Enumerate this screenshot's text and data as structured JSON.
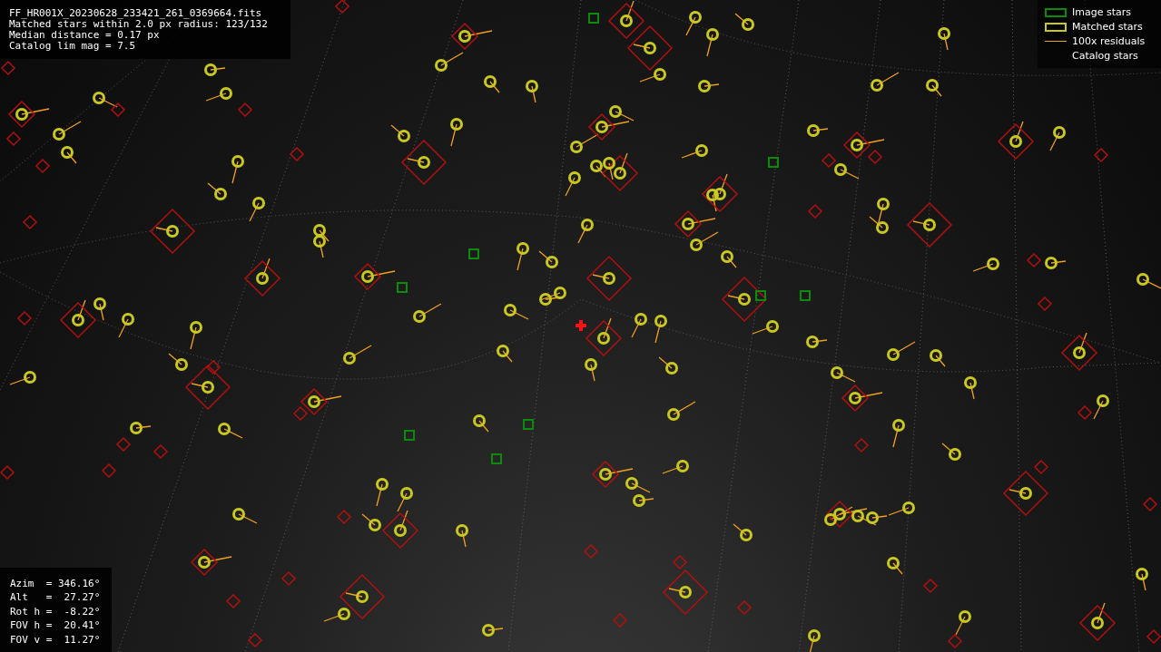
{
  "header": {
    "lines": [
      "FF_HR001X_20230628_233421_261_0369664.fits",
      "Matched stars within 2.0 px radius: 123/132",
      "Median distance = 0.17 px",
      "Catalog lim mag = 7.5"
    ]
  },
  "legend": [
    {
      "kind": "box",
      "color": "#0c8a0c",
      "label": "Image stars"
    },
    {
      "kind": "box",
      "color": "#c8c820",
      "label": "Matched stars"
    },
    {
      "kind": "line",
      "color": "#f0a020",
      "label": "100x residuals"
    },
    {
      "kind": "none",
      "label": "Catalog stars"
    }
  ],
  "pointing": {
    "lines": [
      "Azim  = 346.16°",
      "Alt   =  27.27°",
      "Rot h =  -8.22°",
      "FOV h =  20.41°",
      "FOV v =  11.27°"
    ]
  }
}
